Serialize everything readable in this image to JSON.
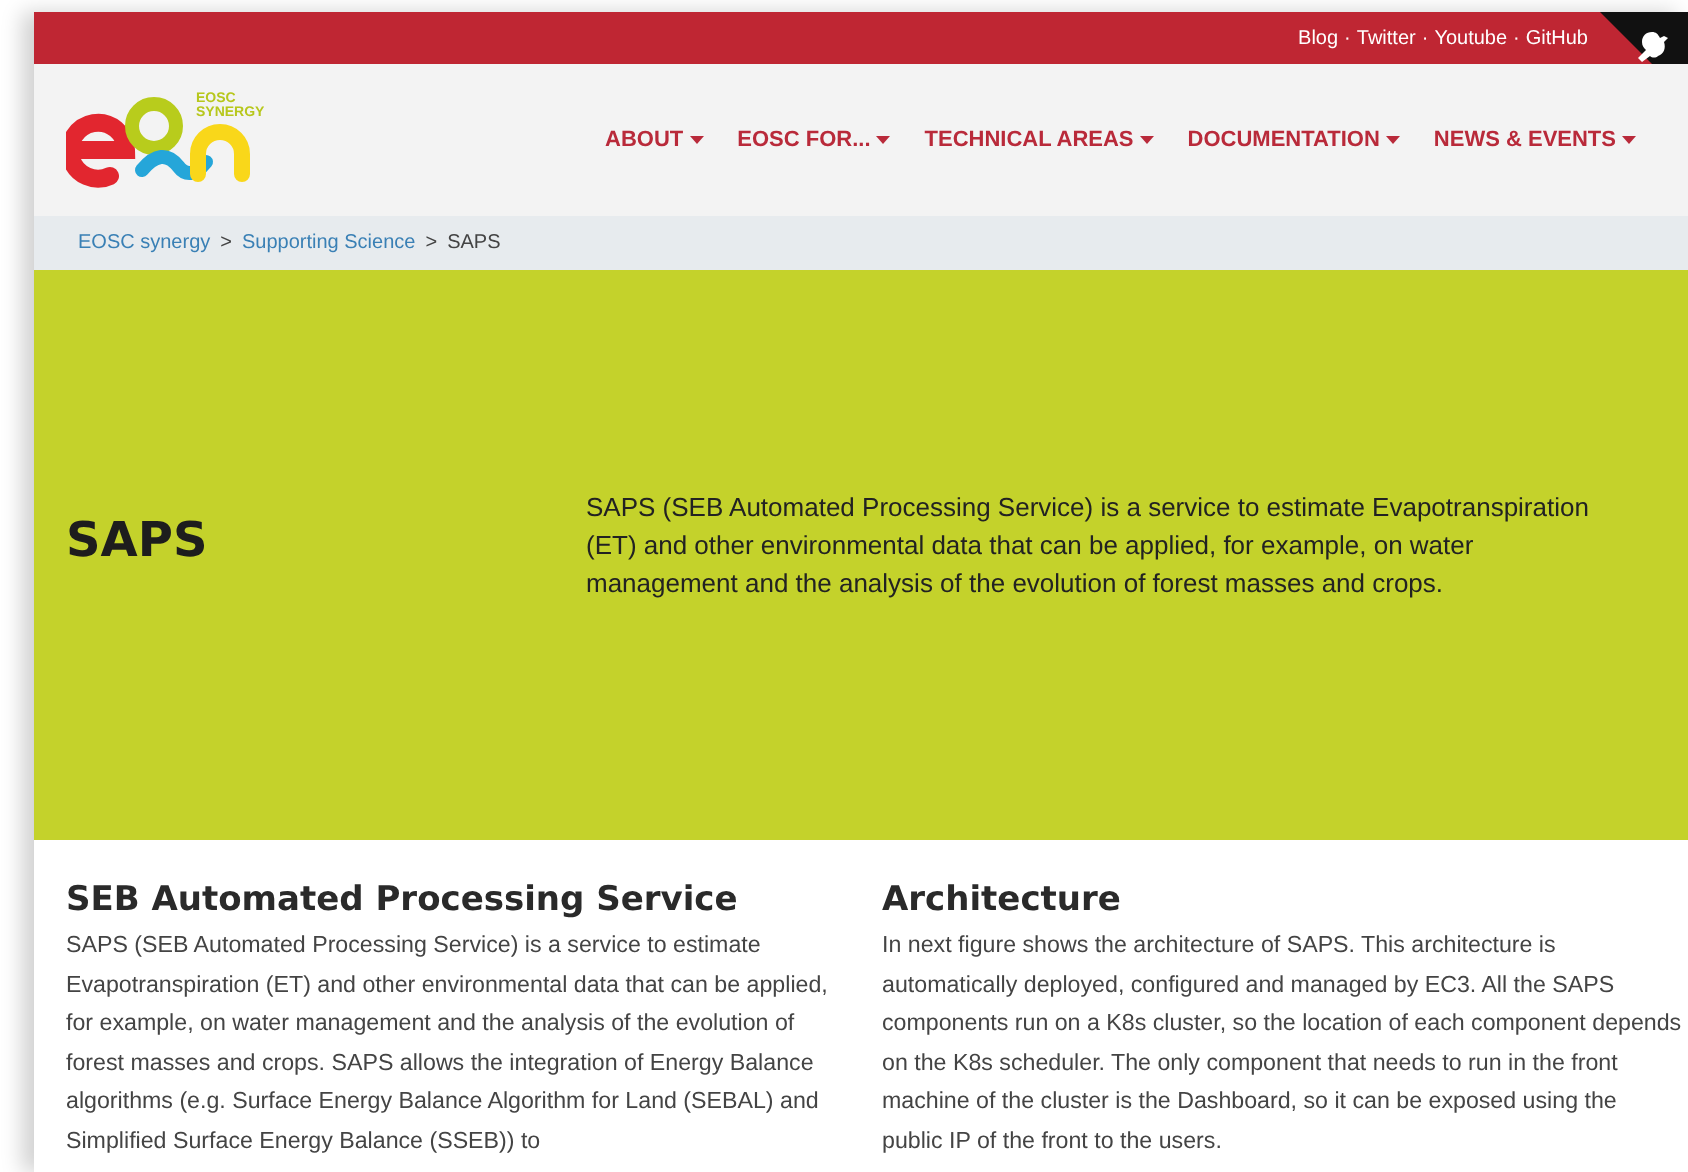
{
  "top_links": [
    "Blog",
    "Twitter",
    "Youtube",
    "GitHub"
  ],
  "top_link_separator": "·",
  "breadcrumb_separator": ">",
  "logo": {
    "text_lines": [
      "EOSC",
      "SYNERGY"
    ]
  },
  "nav": [
    {
      "label": "ABOUT"
    },
    {
      "label": "EOSC FOR..."
    },
    {
      "label": "TECHNICAL AREAS"
    },
    {
      "label": "DOCUMENTATION"
    },
    {
      "label": "NEWS & EVENTS"
    }
  ],
  "breadcrumb": [
    {
      "label": "EOSC synergy",
      "kind": "link"
    },
    {
      "label": "Supporting Science",
      "kind": "link"
    },
    {
      "label": "SAPS",
      "kind": "current"
    }
  ],
  "hero": {
    "title": "SAPS",
    "description": "SAPS (SEB Automated Processing Service) is a service to estimate Evapotranspiration (ET) and other environmental data that can be applied, for example, on water management and the analysis of the evolution of forest masses and crops."
  },
  "sections": [
    {
      "heading": "SEB Automated Processing Service",
      "text": "SAPS (SEB Automated Processing Service) is a service to estimate Evapotranspiration (ET) and other environmental data that can be applied, for example, on water management and the analysis of the evolution of forest masses and crops. SAPS allows the integration of Energy Balance algorithms (e.g. Surface Energy Balance Algorithm for Land (SEBAL)  and Simplified Surface Energy Balance (SSEB)) to"
    },
    {
      "heading": "Architecture",
      "text": "In next figure shows the architecture of SAPS. This architecture is automatically deployed, configured and managed by EC3. All the SAPS components run on a K8s cluster, so the location of each component depends on the K8s scheduler. The only component that needs to run in the front machine of the cluster is the Dashboard, so it can be exposed using the public IP of the front to the users."
    }
  ]
}
